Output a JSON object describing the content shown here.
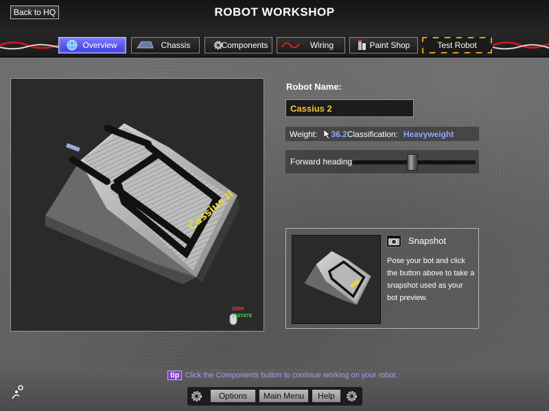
{
  "header": {
    "back_label": "Back to HQ",
    "title": "ROBOT WORKSHOP"
  },
  "tabs": [
    {
      "label": "Overview",
      "icon": "globe-icon",
      "active": true
    },
    {
      "label": "Chassis",
      "icon": "chassis-icon",
      "active": false
    },
    {
      "label": "Components",
      "icon": "gear-icon",
      "active": false
    },
    {
      "label": "Wiring",
      "icon": "wire-icon",
      "active": false
    },
    {
      "label": "Paint Shop",
      "icon": "paint-icon",
      "active": false
    },
    {
      "label": "Test Robot",
      "icon": "",
      "active": false
    }
  ],
  "viewport": {
    "robot_decal": "Cassius II",
    "zoom_hint": "ZOOM",
    "rotate_hint": "ROTATE"
  },
  "robot": {
    "name_label": "Robot Name:",
    "name_value": "Cassius 2",
    "weight_label": "Weight:",
    "weight_value": "36.2",
    "class_label": "Classification:",
    "class_value": "Heavyweight",
    "heading_label": "Forward heading:",
    "heading_level": 0.49
  },
  "snapshot": {
    "title": "Snapshot",
    "description": "Pose your bot and click the button above to take a snapshot used as your bot preview."
  },
  "tip": {
    "badge": "tip",
    "text": "Click the Components button to continue working on your robot."
  },
  "bottom_nav": {
    "options": "Options",
    "main_menu": "Main Menu",
    "help": "Help"
  },
  "colors": {
    "accent_blue": "#5a5aff",
    "name_yellow": "#f2c237",
    "value_blue": "#8ea6ff",
    "tip_purple": "#7a3fc0",
    "hazard": "#e0a020"
  }
}
